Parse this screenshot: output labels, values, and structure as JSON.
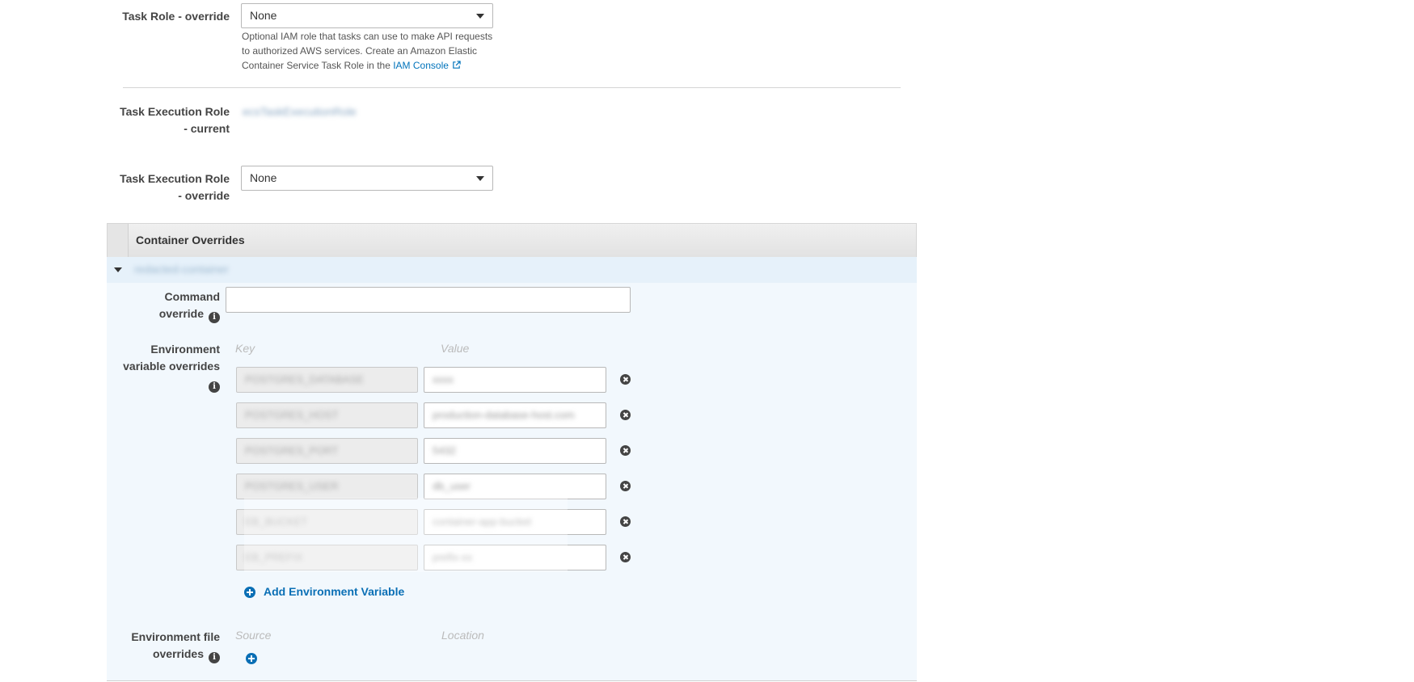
{
  "task_role": {
    "label": "Task Role - override",
    "selected": "None",
    "help_text": "Optional IAM role that tasks can use to make API requests to authorized AWS services. Create an Amazon Elastic Container Service Task Role in the",
    "help_link": "IAM Console"
  },
  "task_execution_current": {
    "label_line1": "Task Execution Role",
    "label_line2": "- current",
    "value": "ecsTaskExecutionRole"
  },
  "task_execution_override": {
    "label_line1": "Task Execution Role",
    "label_line2": "- override",
    "selected": "None"
  },
  "container_overrides": {
    "title": "Container Overrides",
    "container_name": "redacted-container",
    "command": {
      "label_line1": "Command",
      "label_line2": "override",
      "value": ""
    },
    "env": {
      "label_line1": "Environment",
      "label_line2": "variable overrides",
      "key_header": "Key",
      "value_header": "Value",
      "rows": [
        {
          "key": "POSTGRES_DATABASE",
          "value": "xxxx"
        },
        {
          "key": "POSTGRES_HOST",
          "value": "production-database-host.com"
        },
        {
          "key": "POSTGRES_PORT",
          "value": "5432"
        },
        {
          "key": "POSTGRES_USER",
          "value": "db_user"
        },
        {
          "key": "EB_BUCKET",
          "value": "container-app-bucket"
        },
        {
          "key": "EB_PREFIX",
          "value": "prefix-xx"
        }
      ],
      "add_label": "Add Environment Variable"
    },
    "env_file": {
      "label_line1": "Environment file",
      "label_line2": "overrides",
      "source_header": "Source",
      "location_header": "Location"
    }
  },
  "colors": {
    "link": "#0073bb",
    "panel_bg": "#f2f8fd"
  }
}
